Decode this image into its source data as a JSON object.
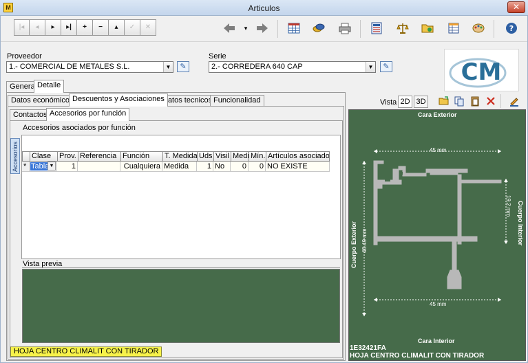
{
  "window": {
    "title": "Articulos",
    "app_icon_glyph": "M",
    "close_glyph": "✕"
  },
  "toolbar": {
    "nav": [
      "|◂",
      "◂",
      "▸",
      "▸|",
      "+",
      "−",
      "▴",
      "✓",
      "✕"
    ],
    "icons": [
      "back-arrow-icon",
      "forward-arrow-icon",
      "grid-icon",
      "coins-icon",
      "printer-icon",
      "calculator-icon",
      "scale-icon",
      "folder-icon",
      "sheet-icon",
      "palette-icon",
      "help-icon"
    ],
    "help_glyph": "?"
  },
  "header": {
    "proveedor_label": "Proveedor",
    "proveedor_value": "1.- COMERCIAL DE METALES S.L.",
    "serie_label": "Serie",
    "serie_value": "2.- CORREDERA 640 CAP",
    "logo_text": "CM"
  },
  "tabs_top": [
    "General",
    "Detalle"
  ],
  "tabs_mid": [
    "Datos económicos",
    "Descuentos y Asociaciones",
    "Datos tecnicos",
    "Funcionalidad"
  ],
  "tabs_sub": [
    "Contactos",
    "Accesorios por función"
  ],
  "accessories": {
    "vertical_tab": "Accesorios",
    "section_title": "Accesorios asociados por función",
    "columns": [
      "Clase",
      "Prov.",
      "Referencia",
      "Función",
      "T. Medida",
      "Uds",
      "Visil",
      "Medi",
      "Mín.",
      "Artículos asociados"
    ],
    "rows": [
      {
        "marker": "*",
        "clase": "Tabla",
        "prov": "1",
        "referencia": "",
        "funcion": "Cualquiera",
        "t_medida": "Medida",
        "uds": "1",
        "visible": "No",
        "medi": "0",
        "min": "0",
        "articulos": "NO EXISTE"
      }
    ],
    "preview_label": "Vista previa"
  },
  "status_label": "HOJA CENTRO CLIMALIT CON TIRADOR",
  "drawing": {
    "vista_label": "Vista",
    "btn_2d": "2D",
    "btn_3d": "3D",
    "cara_exterior": "Cara Exterior",
    "cara_interior": "Cara Interior",
    "cuerpo_exterior": "Cuerpo Exterior",
    "cuerpo_interior": "Cuerpo Interior",
    "dim_top": "45 mm",
    "dim_bottom": "45 mm",
    "dim_left": "48.49 mm",
    "dim_right": "19.2 mm",
    "code": "1E32421FA",
    "name": "HOJA CENTRO CLIMALIT CON TIRADOR",
    "profile_color": "#b8b8b8",
    "bg_color": "#466b4a"
  }
}
